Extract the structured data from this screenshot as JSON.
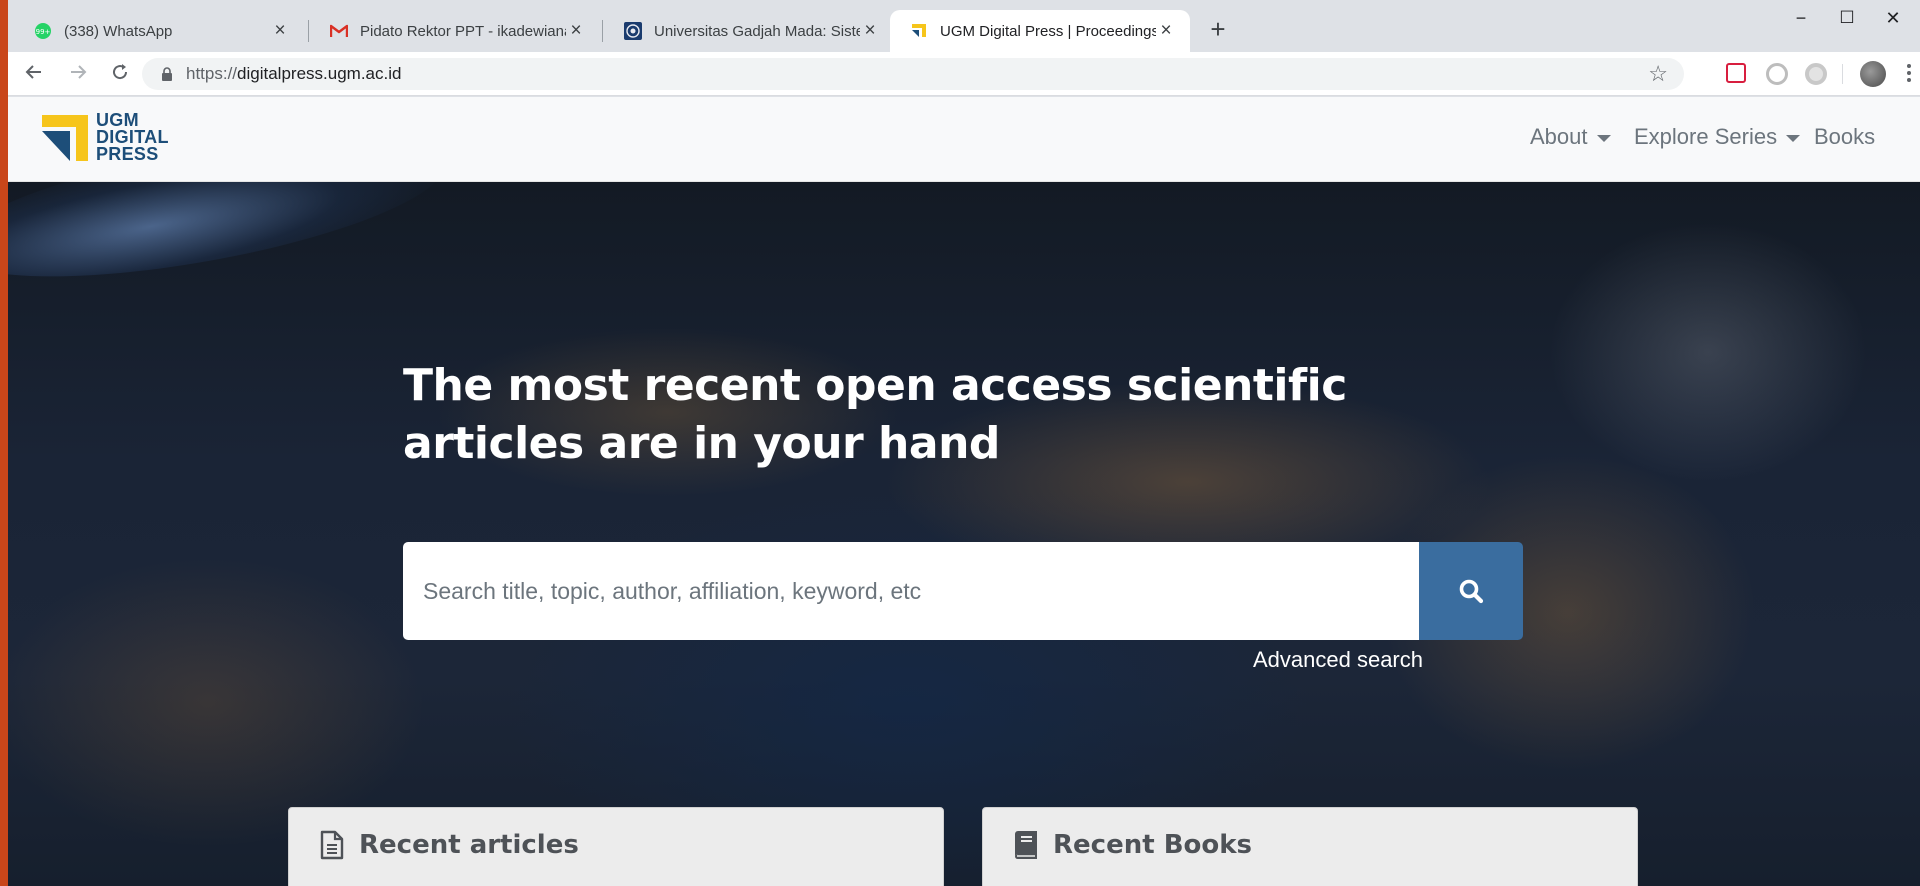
{
  "browser": {
    "tabs": [
      {
        "title": "(338) WhatsApp",
        "favicon": "whatsapp-icon",
        "active": false
      },
      {
        "title": "Pidato Rektor PPT - ikadewiana@",
        "favicon": "gmail-icon",
        "active": false
      },
      {
        "title": "Universitas Gadjah Mada: Sistem",
        "favicon": "ugm-seal-icon",
        "active": false
      },
      {
        "title": "UGM Digital Press | Proceedings",
        "favicon": "ugm-press-icon",
        "active": true
      }
    ],
    "new_tab": "+",
    "controls": {
      "minimize": "−",
      "maximize": "☐",
      "close": "✕"
    },
    "url_scheme": "https://",
    "url_host": "digitalpress.ugm.ac.id"
  },
  "site": {
    "logo_lines": [
      "UGM",
      "DIGITAL",
      "PRESS"
    ],
    "nav": [
      {
        "label": "About",
        "dropdown": true
      },
      {
        "label": "Explore Series",
        "dropdown": true
      },
      {
        "label": "Books",
        "dropdown": false
      }
    ],
    "hero_title": "The most recent open access scientific articles are in your hand",
    "search_placeholder": "Search title, topic, author, affiliation, keyword, etc",
    "advanced_search": "Advanced search",
    "cards": [
      {
        "title": "Recent articles",
        "icon": "document-icon"
      },
      {
        "title": "Recent Books",
        "icon": "book-icon"
      }
    ]
  },
  "colors": {
    "brand_blue": "#1d4e79",
    "brand_yellow": "#f6c51b",
    "search_button": "#3a6d9f",
    "nav_text": "#6c757d"
  }
}
